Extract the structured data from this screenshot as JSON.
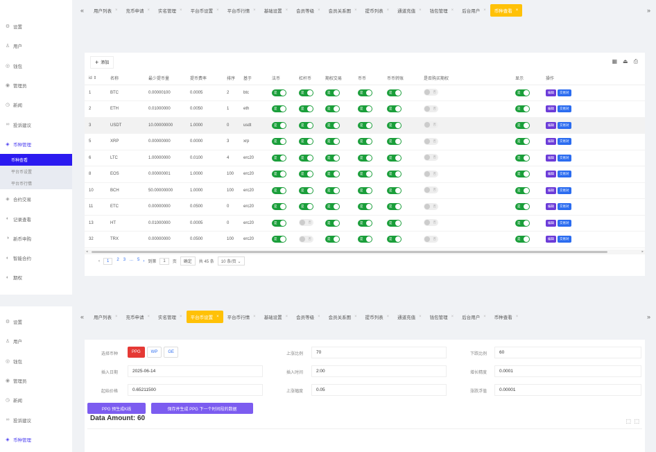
{
  "sidebar_top": {
    "items": [
      {
        "icon": "gear-icon",
        "glyph": "⚙",
        "label": "设置"
      },
      {
        "icon": "user-icon",
        "glyph": "♙",
        "label": "用户"
      },
      {
        "icon": "wallet-icon",
        "glyph": "◎",
        "label": "钱包"
      },
      {
        "icon": "admin-icon",
        "glyph": "◉",
        "label": "管理员"
      },
      {
        "icon": "news-icon",
        "glyph": "◷",
        "label": "新闻"
      },
      {
        "icon": "feedback-icon",
        "glyph": "∞",
        "label": "投诉建议"
      },
      {
        "icon": "coin-icon",
        "glyph": "◈",
        "label": "币种管理",
        "active": true
      }
    ],
    "sub": [
      "币种查看",
      "平台币设置",
      "平台币行情"
    ],
    "items_after": [
      {
        "icon": "contract-icon",
        "glyph": "◈",
        "label": "合约交易"
      },
      {
        "icon": "record-icon",
        "glyph": "◐",
        "label": "记录查看"
      },
      {
        "icon": "newcoin-icon",
        "glyph": "◑",
        "label": "新币申购"
      },
      {
        "icon": "smart-icon",
        "glyph": "◐",
        "label": "智能合约"
      },
      {
        "icon": "options-icon",
        "glyph": "◐",
        "label": "期权"
      }
    ]
  },
  "tabs_top": [
    "用户列表",
    "充币申请",
    "实名管理",
    "平台币设置",
    "平台币行情",
    "基础设置",
    "会员等级",
    "会员关系图",
    "提币列表",
    "通道充值",
    "钱包管理",
    "后台用户",
    "币种查看"
  ],
  "tabs_top_active": "币种查看",
  "toolbar": {
    "add_label": "添加"
  },
  "table": {
    "headers": [
      "id ⇕",
      "名称",
      "最少提币量",
      "提币费率",
      "排序",
      "基于",
      "法币",
      "杠杆币",
      "期权交易",
      "币币",
      "币币转账",
      "是否购买期权",
      "显示",
      "操作"
    ],
    "rows": [
      {
        "id": "1",
        "name": "BTC",
        "min": "0.00000100",
        "fee": "0.0005",
        "sort": "2",
        "base": "btc",
        "legal": true,
        "lever": true,
        "option": true,
        "coin": true,
        "transfer": true,
        "buy": false,
        "show": true
      },
      {
        "id": "2",
        "name": "ETH",
        "min": "0.01000000",
        "fee": "0.0050",
        "sort": "1",
        "base": "eth",
        "legal": true,
        "lever": true,
        "option": true,
        "coin": true,
        "transfer": true,
        "buy": false,
        "show": true
      },
      {
        "id": "3",
        "name": "USDT",
        "min": "10.00000000",
        "fee": "1.0000",
        "sort": "0",
        "base": "usdt",
        "legal": true,
        "lever": true,
        "option": true,
        "coin": true,
        "transfer": true,
        "buy": false,
        "show": true,
        "hl": true
      },
      {
        "id": "5",
        "name": "XRP",
        "min": "0.00000000",
        "fee": "0.0000",
        "sort": "3",
        "base": "xrp",
        "legal": true,
        "lever": true,
        "option": true,
        "coin": true,
        "transfer": true,
        "buy": false,
        "show": true
      },
      {
        "id": "6",
        "name": "LTC",
        "min": "1.00000000",
        "fee": "0.0100",
        "sort": "4",
        "base": "erc20",
        "legal": true,
        "lever": true,
        "option": true,
        "coin": true,
        "transfer": true,
        "buy": false,
        "show": true
      },
      {
        "id": "8",
        "name": "EOS",
        "min": "0.00000001",
        "fee": "1.0000",
        "sort": "100",
        "base": "erc20",
        "legal": true,
        "lever": true,
        "option": true,
        "coin": true,
        "transfer": true,
        "buy": false,
        "show": true
      },
      {
        "id": "10",
        "name": "BCH",
        "min": "50.00000000",
        "fee": "1.0000",
        "sort": "100",
        "base": "erc20",
        "legal": true,
        "lever": true,
        "option": true,
        "coin": true,
        "transfer": true,
        "buy": false,
        "show": true
      },
      {
        "id": "11",
        "name": "ETC",
        "min": "0.00000000",
        "fee": "0.0500",
        "sort": "0",
        "base": "erc20",
        "legal": true,
        "lever": true,
        "option": true,
        "coin": true,
        "transfer": true,
        "buy": false,
        "show": true
      },
      {
        "id": "13",
        "name": "HT",
        "min": "0.01000000",
        "fee": "0.0005",
        "sort": "0",
        "base": "erc20",
        "legal": true,
        "lever": false,
        "option": true,
        "coin": true,
        "transfer": true,
        "buy": false,
        "show": true
      },
      {
        "id": "32",
        "name": "TRX",
        "min": "0.00000000",
        "fee": "0.0500",
        "sort": "100",
        "base": "erc20",
        "legal": true,
        "lever": false,
        "option": true,
        "coin": true,
        "transfer": true,
        "buy": false,
        "show": true
      }
    ],
    "on_label": "是",
    "off_label": "否",
    "edit_label": "编辑",
    "trade_label": "交易对"
  },
  "pager": {
    "prev": "‹",
    "pages": [
      "1",
      "2",
      "3",
      "...",
      "5"
    ],
    "next": "›",
    "goto": "到第",
    "page_value": "1",
    "page_unit": "页",
    "confirm": "确定",
    "total": "共 45 条",
    "per_page": "10 条/页 ⌄"
  },
  "sidebar_bottom": {
    "items": [
      {
        "icon": "gear-icon",
        "glyph": "⚙",
        "label": "设置"
      },
      {
        "icon": "user-icon",
        "glyph": "♙",
        "label": "用户"
      },
      {
        "icon": "wallet-icon",
        "glyph": "◎",
        "label": "钱包"
      },
      {
        "icon": "admin-icon",
        "glyph": "◉",
        "label": "管理员"
      },
      {
        "icon": "news-icon",
        "glyph": "◷",
        "label": "新闻"
      },
      {
        "icon": "feedback-icon",
        "glyph": "∞",
        "label": "投诉建议"
      },
      {
        "icon": "coin-icon",
        "glyph": "◈",
        "label": "币种管理",
        "active": true
      }
    ]
  },
  "tabs_bottom": [
    "用户列表",
    "充币申请",
    "实名管理",
    "平台币设置",
    "平台币行情",
    "基础设置",
    "会员等级",
    "会员关系图",
    "提币列表",
    "通道充值",
    "钱包管理",
    "后台用户",
    "币种查看"
  ],
  "tabs_bottom_active": "平台币设置",
  "form": {
    "coin_label": "选择币种",
    "coins": [
      "PPG",
      "WP",
      "GE"
    ],
    "coin_selected": "PPG",
    "insert_date_label": "插入日期",
    "insert_date": "2025-06-14",
    "start_price_label": "起始价格",
    "start_price": "0.65211500",
    "up_ratio_label": "上涨比例",
    "up_ratio": "70",
    "insert_time_label": "插入时间",
    "insert_time": "2:00",
    "up_range_label": "上涨幅度",
    "up_range": "0.05",
    "down_ratio_label": "下跌比例",
    "down_ratio": "60",
    "precision_label": "增长精度",
    "precision": "0.0001",
    "float_label": "涨跌浮值",
    "float": "0.00001",
    "btn_predict": "PPG 预生成K线",
    "btn_save": "保存并生成 PPG 下一个时间段的数据",
    "data_amount": "Data Amount: 60"
  }
}
